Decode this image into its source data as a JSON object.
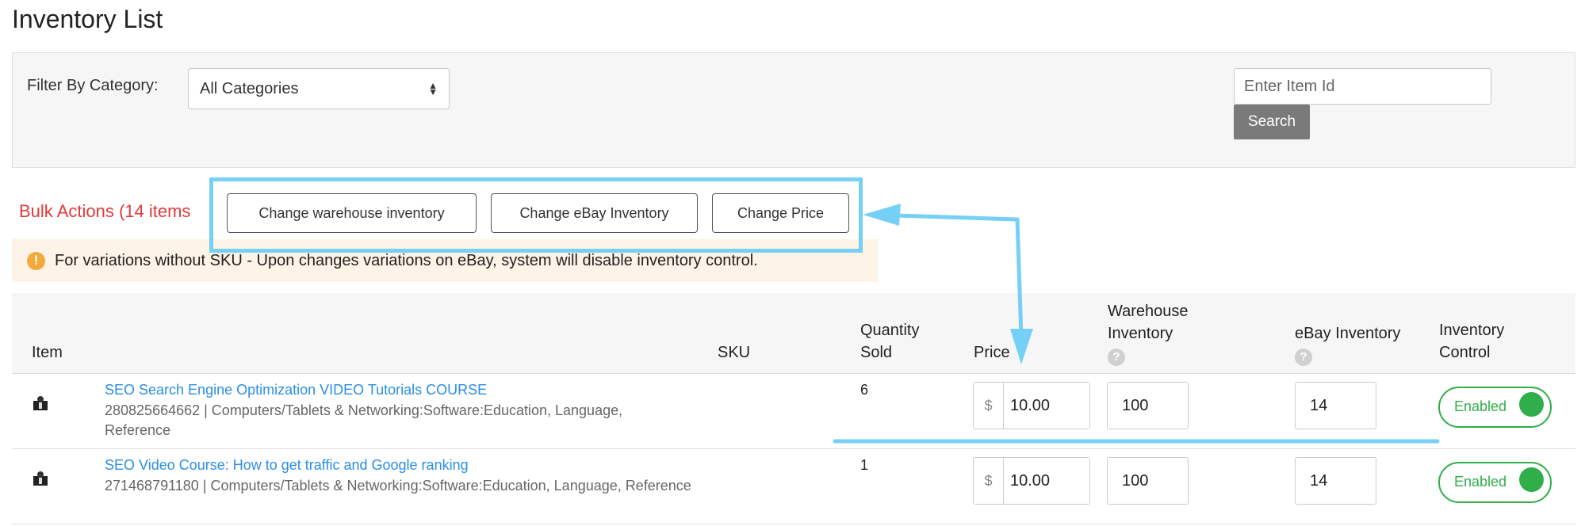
{
  "page": {
    "title": "Inventory List"
  },
  "filter": {
    "label": "Filter By Category:",
    "category_value": "All Categories",
    "search_placeholder": "Enter Item Id",
    "search_button": "Search"
  },
  "bulk": {
    "label": "Bulk Actions (14 items",
    "buttons": [
      "Change warehouse inventory",
      "Change eBay Inventory",
      "Change Price"
    ]
  },
  "notice": {
    "text": "For variations without SKU - Upon changes variations on eBay, system will disable inventory control."
  },
  "table": {
    "headers": {
      "item": "Item",
      "sku": "SKU",
      "quantity_sold": [
        "Quantity",
        "Sold"
      ],
      "price": "Price",
      "warehouse_inventory": [
        "Warehouse",
        "Inventory"
      ],
      "ebay_inventory": "eBay Inventory",
      "inventory_control": [
        "Inventory",
        "Control"
      ],
      "help_symbol": "?"
    },
    "rows": [
      {
        "title": "SEO Search Engine Optimization VIDEO Tutorials COURSE",
        "meta": "280825664662 | Computers/Tablets & Networking:Software:Education, Language, Reference",
        "sku": "",
        "quantity_sold": "6",
        "currency": "$",
        "price": "10.00",
        "warehouse_inventory": "100",
        "ebay_inventory": "14",
        "control": "Enabled"
      },
      {
        "title": "SEO Video Course: How to get traffic and Google ranking",
        "meta": "271468791180 | Computers/Tablets & Networking:Software:Education, Language, Reference",
        "sku": "",
        "quantity_sold": "1",
        "currency": "$",
        "price": "10.00",
        "warehouse_inventory": "100",
        "ebay_inventory": "14",
        "control": "Enabled"
      }
    ]
  },
  "colors": {
    "accent_link": "#2a8ee8",
    "bulk_label": "#e03a3a",
    "toggle_on": "#2fae49",
    "annotation": "#76d0f5",
    "notice_bg": "#fdf3e6",
    "notice_icon": "#f4a93b"
  },
  "icons": {
    "notice": "exclamation-circle-icon",
    "help": "question-circle-icon",
    "select": "sort-arrows-icon",
    "thumbnail": "item-thumbnail-icon"
  }
}
